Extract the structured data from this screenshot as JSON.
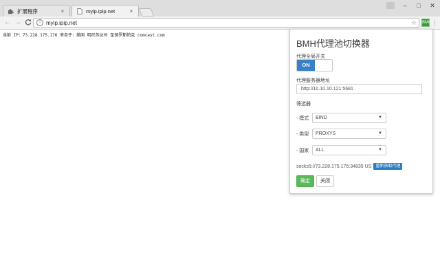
{
  "browser": {
    "tabs": [
      {
        "label": "扩展程序",
        "icon": "puzzle-icon"
      },
      {
        "label": "myip.ipip.net",
        "icon": "page-icon"
      }
    ],
    "tab_close_glyph": "×",
    "window_controls": {
      "minimize": "–",
      "maximize": "□",
      "close": "✕"
    },
    "nav": {
      "back": "←",
      "forward": "→",
      "reload": "C"
    },
    "address": {
      "info_glyph": "i",
      "url": "myip.ipip.net",
      "star": "☆"
    },
    "extension_badge": "BMH",
    "menu_glyph": "⋮"
  },
  "page": {
    "ip_line": "当前 IP：73.228.175.176  来自于：美国 明尼苏达州 圣保罗斯帕克 comcast.com"
  },
  "popup": {
    "title": "BMH代理池切换器",
    "global_switch_label": "代理全局开关",
    "toggle_on_label": "ON",
    "server_label": "代理服务器地址",
    "server_value": "http://10.10.10.121:5681",
    "filter_label": "筛选器",
    "filters": [
      {
        "label": "- 模式",
        "value": "BIND"
      },
      {
        "label": "- 类型",
        "value": "PROXYS"
      },
      {
        "label": "- 国家",
        "value": "ALL"
      }
    ],
    "status_text": "socks5://73.228.175.176:34835 US",
    "refresh_label": "重新获取代理",
    "confirm_label": "确定",
    "close_label": "关闭",
    "colors": {
      "primary": "#3b7fc4",
      "success": "#5cb85c",
      "refresh": "#2a7bbf"
    }
  }
}
